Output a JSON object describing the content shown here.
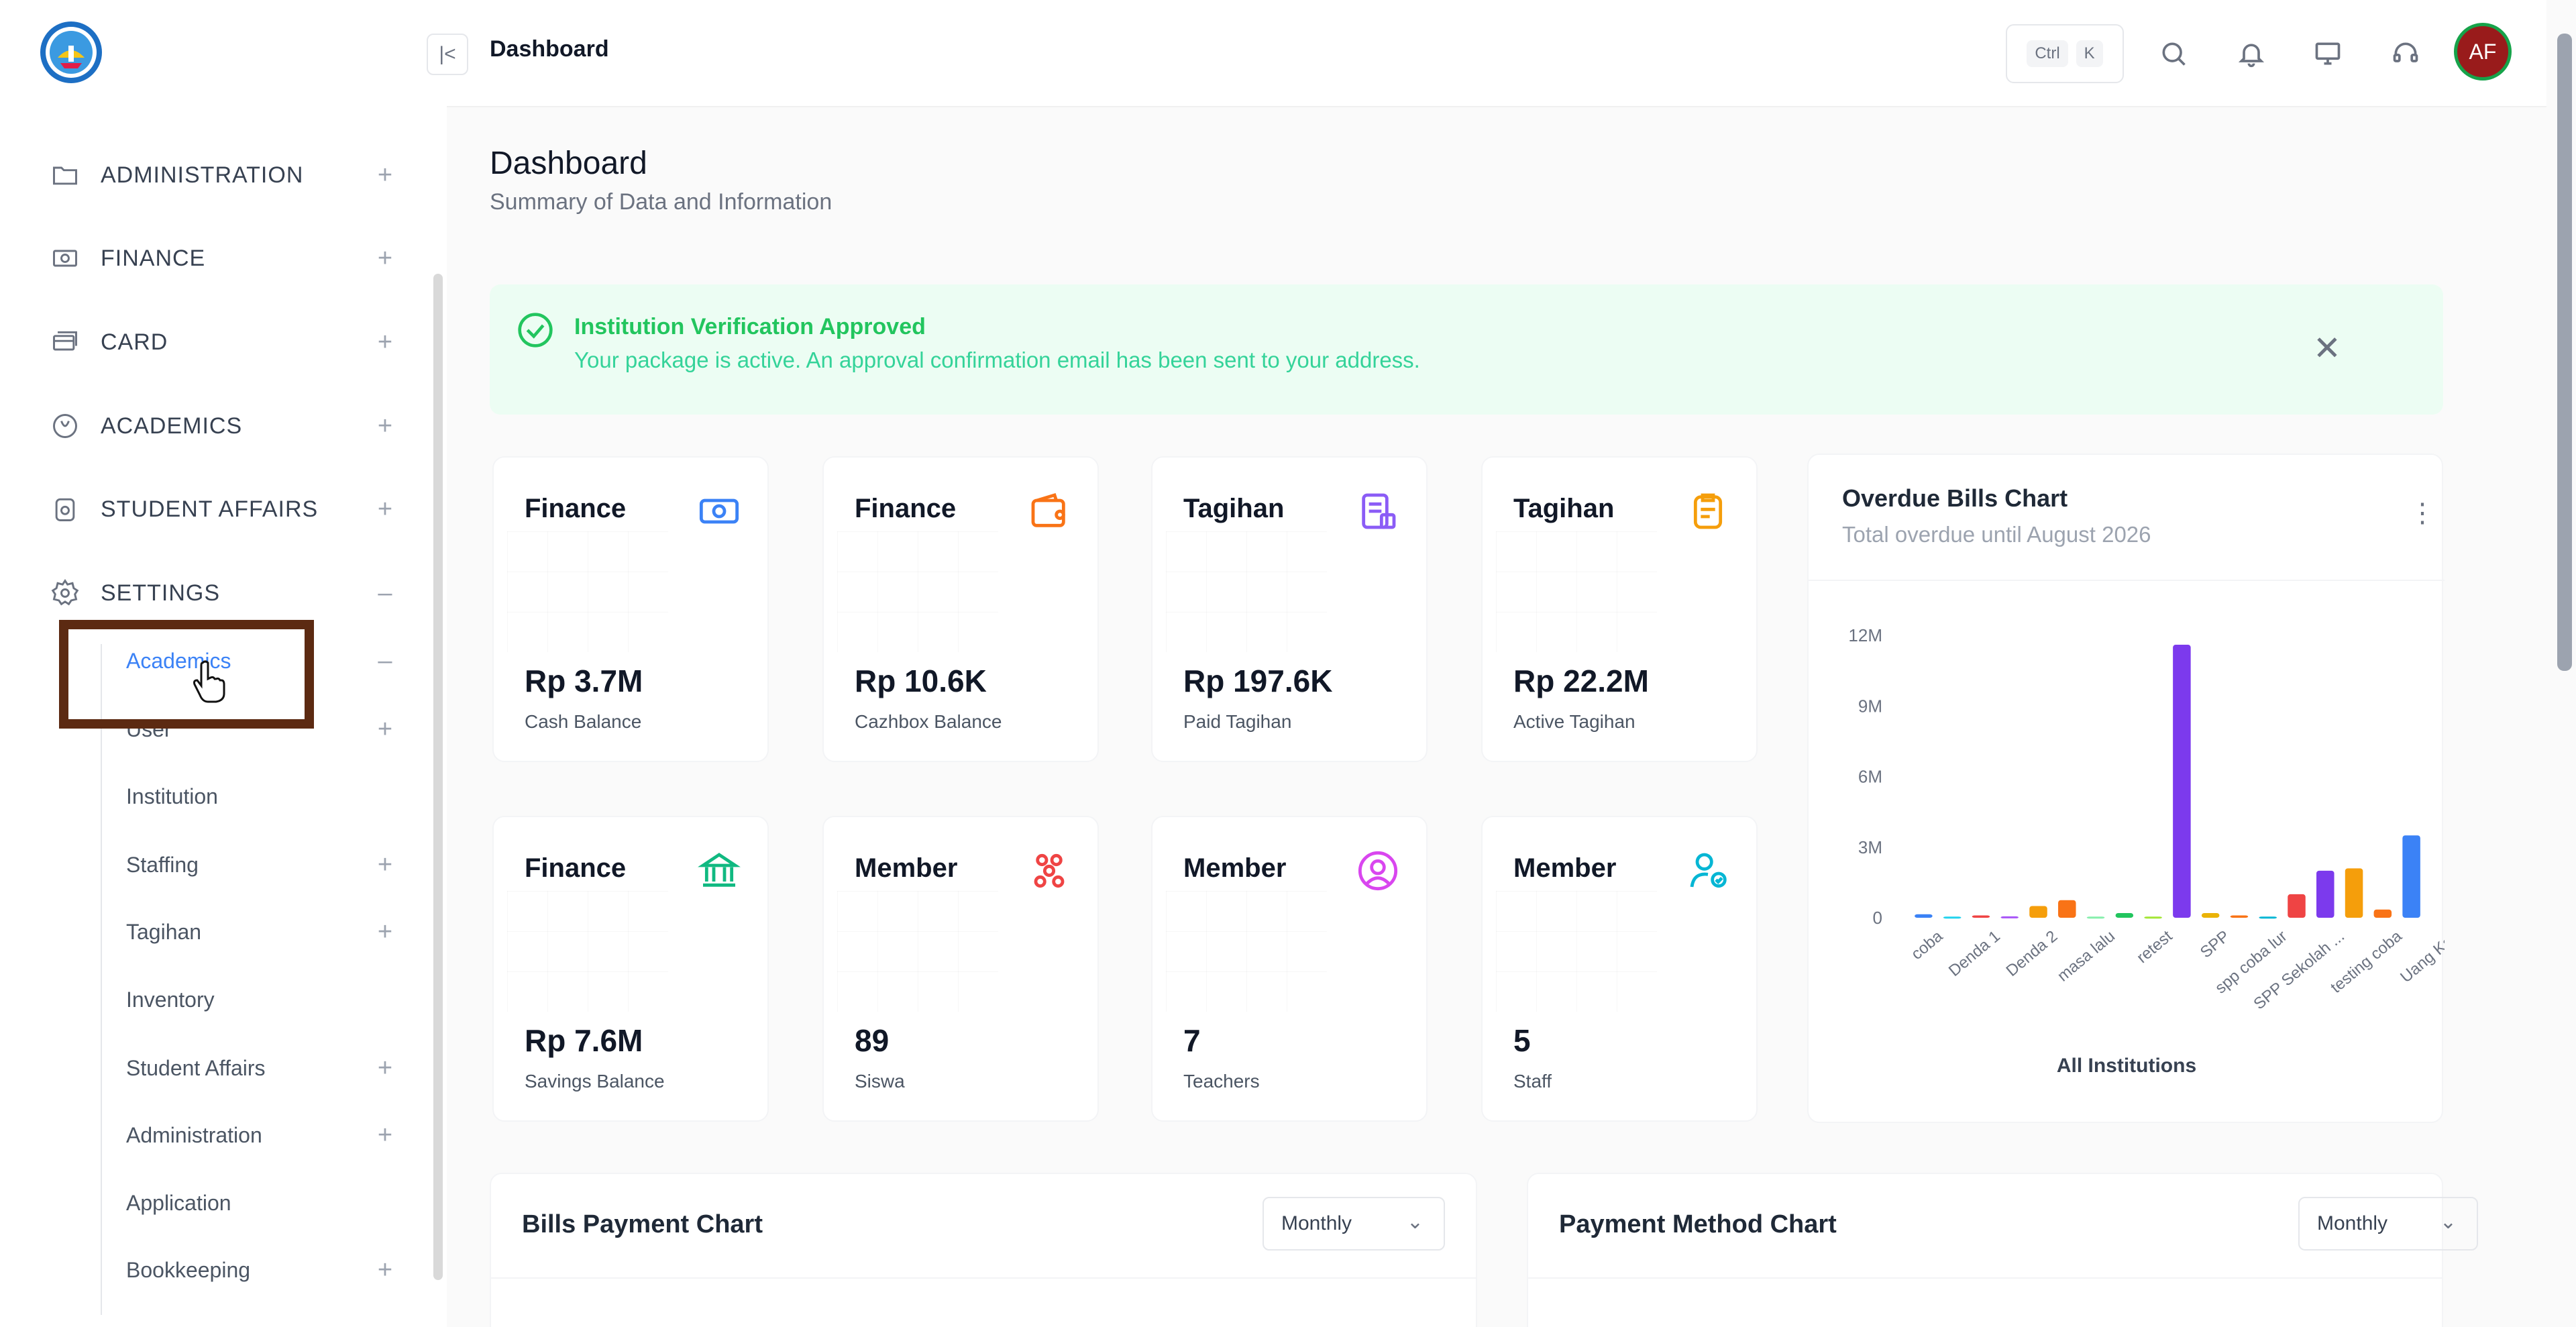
{
  "topbar": {
    "breadcrumb": "Dashboard",
    "kbd_ctrl": "Ctrl",
    "kbd_k": "K",
    "avatar_initials": "AF"
  },
  "sidebar": {
    "items": [
      {
        "label": "ADMINISTRATION",
        "icon": "folder-icon",
        "toggle": "+"
      },
      {
        "label": "FINANCE",
        "icon": "cash-icon",
        "toggle": "+"
      },
      {
        "label": "CARD",
        "icon": "card-icon",
        "toggle": "+"
      },
      {
        "label": "ACADEMICS",
        "icon": "academics-icon",
        "toggle": "+"
      },
      {
        "label": "STUDENT AFFAIRS",
        "icon": "student-affairs-icon",
        "toggle": "+"
      },
      {
        "label": "SETTINGS",
        "icon": "gear-icon",
        "toggle": "–"
      }
    ],
    "settings_sub": [
      {
        "label": "Academics",
        "toggle": "–"
      },
      {
        "label": "User",
        "toggle": "+"
      },
      {
        "label": "Institution",
        "toggle": ""
      },
      {
        "label": "Staffing",
        "toggle": "+"
      },
      {
        "label": "Tagihan",
        "toggle": "+"
      },
      {
        "label": "Inventory",
        "toggle": ""
      },
      {
        "label": "Student Affairs",
        "toggle": "+"
      },
      {
        "label": "Administration",
        "toggle": "+"
      },
      {
        "label": "Application",
        "toggle": ""
      },
      {
        "label": "Bookkeeping",
        "toggle": "+"
      }
    ]
  },
  "page": {
    "title": "Dashboard",
    "subtitle": "Summary of Data and Information"
  },
  "alert": {
    "title": "Institution Verification Approved",
    "text": "Your package is active. An approval confirmation email has been sent to your address.",
    "close": "✕"
  },
  "cards": [
    {
      "title": "Finance",
      "value": "Rp 3.7M",
      "label": "Cash Balance",
      "icon": "cash-icon",
      "color": "#3b82f6"
    },
    {
      "title": "Finance",
      "value": "Rp 10.6K",
      "label": "Cazhbox Balance",
      "icon": "wallet-icon",
      "color": "#f97316"
    },
    {
      "title": "Tagihan",
      "value": "Rp 197.6K",
      "label": "Paid Tagihan",
      "icon": "receipt-icon",
      "color": "#8b5cf6"
    },
    {
      "title": "Tagihan",
      "value": "Rp 22.2M",
      "label": "Active Tagihan",
      "icon": "clipboard-icon",
      "color": "#f59e0b"
    },
    {
      "title": "Finance",
      "value": "Rp 7.6M",
      "label": "Savings Balance",
      "icon": "bank-icon",
      "color": "#10b981"
    },
    {
      "title": "Member",
      "value": "89",
      "label": "Siswa",
      "icon": "group-icon",
      "color": "#ef4444"
    },
    {
      "title": "Member",
      "value": "7",
      "label": "Teachers",
      "icon": "user-circle-icon",
      "color": "#d946ef"
    },
    {
      "title": "Member",
      "value": "5",
      "label": "Staff",
      "icon": "user-check-icon",
      "color": "#06b6d4"
    }
  ],
  "overdue_chart": {
    "title": "Overdue Bills Chart",
    "subtitle": "Total overdue until August 2026",
    "footer": "All Institutions",
    "menu": "⋮"
  },
  "chart_data": {
    "type": "bar",
    "title": "Overdue Bills Chart",
    "ylim": [
      0,
      12000000
    ],
    "yticks": [
      "0",
      "3M",
      "6M",
      "9M",
      "12M"
    ],
    "ytick_values": [
      0,
      3000000,
      6000000,
      9000000,
      12000000
    ],
    "xlabel": "All Institutions",
    "categories": [
      "coba",
      "",
      "Denda 1",
      "",
      "Denda 2",
      "",
      "masa lalu",
      "",
      "retest",
      "",
      "SPP",
      "",
      "spp coba lur",
      "",
      "SPP Sekolah ...",
      "",
      "testing coba",
      "",
      "Uang Kas"
    ],
    "values": [
      150000,
      50000,
      100000,
      60000,
      500000,
      750000,
      50000,
      200000,
      50000,
      11600000,
      200000,
      100000,
      50000,
      1000000,
      2000000,
      2100000,
      350000,
      3500000
    ],
    "colors": [
      "#3b82f6",
      "#22d3ee",
      "#ef4444",
      "#a855f7",
      "#f59e0b",
      "#f97316",
      "#86efac",
      "#22c55e",
      "#a3e635",
      "#7c3aed",
      "#eab308",
      "#f97316",
      "#06b6d4",
      "#ef4444",
      "#7c3aed",
      "#f59e0b",
      "#f97316",
      "#3b82f6"
    ],
    "xticks": [
      "coba",
      "Denda 1",
      "Denda 2",
      "masa lalu",
      "retest",
      "SPP",
      "spp coba lur",
      "SPP Sekolah ...",
      "testing coba",
      "Uang Kas"
    ],
    "grid": false,
    "legend": "none"
  },
  "bills_payment": {
    "title": "Bills Payment Chart",
    "period": "Monthly"
  },
  "payment_method": {
    "title": "Payment Method Chart",
    "period": "Monthly"
  }
}
